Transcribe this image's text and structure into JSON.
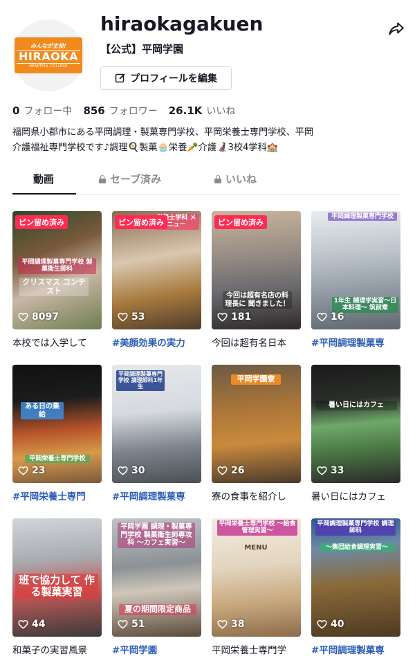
{
  "profile": {
    "logo_top": "みんなが主役!",
    "logo_main": "HIRAOKA",
    "logo_sub": "HEARTFUL COLLEGE",
    "username": "hiraokagakuen",
    "nickname": "【公式】平岡学園",
    "edit_label": "プロフィールを編集"
  },
  "stats": [
    {
      "num": "0",
      "label": "フォロー中"
    },
    {
      "num": "856",
      "label": "フォロワー"
    },
    {
      "num": "26.1K",
      "label": "いいね"
    }
  ],
  "bio": {
    "line1": "福岡県小郡市にある平岡調理・製菓専門学校、平岡栄養士専門学校、平岡",
    "line2": "介護福祉専門学校です♪調理🍳製菓🧁栄養🥕介護👩‍🦼3校4学科🏫"
  },
  "tabs": [
    {
      "label": "動画"
    },
    {
      "label": "セーブ済み"
    },
    {
      "label": "いいね"
    }
  ],
  "videos": [
    {
      "views": "8097",
      "pin": "ピン留め済み",
      "overlay": "平岡調理製菓専門学校 製菓衛生師科",
      "overlay2": "クリスマス コンテスト",
      "caption": "本校では入学して",
      "tag": false
    },
    {
      "views": "53",
      "pin": "ピン留め済み",
      "overlay": "栄養士学科 メニュー",
      "overlay2": "",
      "caption": "#美顔効果の実力",
      "tag": true
    },
    {
      "views": "181",
      "pin": "ピン留め済み",
      "overlay": "",
      "overlay2": "今回は超有名店の料理長に 聞きました！",
      "caption": "今回は超有名日本",
      "tag": false
    },
    {
      "views": "16",
      "pin": "",
      "overlay": "平岡調理製菓専門学校",
      "overlay2": "1年生 調理学実習～日本料理～ 筑前煮",
      "caption": "#平岡調理製菓専",
      "tag": true
    },
    {
      "views": "23",
      "pin": "",
      "overlay": "ある日の集給",
      "overlay2": "平岡栄養士専門学校",
      "caption": "#平岡栄養士専門",
      "tag": true
    },
    {
      "views": "30",
      "pin": "",
      "overlay": "平岡調理製菓専門学校 調理師科1年生",
      "overlay2": "",
      "caption": "#平岡調理製菓専",
      "tag": true
    },
    {
      "views": "26",
      "pin": "",
      "overlay": "平岡学園寮",
      "overlay2": "",
      "caption": "寮の食事を紹介し",
      "tag": false
    },
    {
      "views": "33",
      "pin": "",
      "overlay": "暑い日にはカフェ",
      "overlay2": "",
      "caption": "暑い日にはカフェ",
      "tag": false
    },
    {
      "views": "44",
      "pin": "",
      "overlay": "班で協力して 作る製菓実習",
      "overlay2": "",
      "caption": "和菓子の実習風景",
      "tag": false
    },
    {
      "views": "51",
      "pin": "",
      "overlay": "平岡学園 調理・製菓専門学校 製菓衛生師専攻科 ～カフェ実習～",
      "overlay2": "夏の期間限定商品",
      "caption": "#平岡学園",
      "tag": true
    },
    {
      "views": "38",
      "pin": "",
      "overlay": "平岡栄養士専門学校 ～給食管理実習～",
      "overlay2": "MENU",
      "caption": "平岡栄養士専門学",
      "tag": false
    },
    {
      "views": "40",
      "pin": "",
      "overlay": "平岡調理製菓専門学校 調理師科",
      "overlay2": "～集団給食調理実習～",
      "caption": "#平岡調理製菓専",
      "tag": true
    }
  ]
}
